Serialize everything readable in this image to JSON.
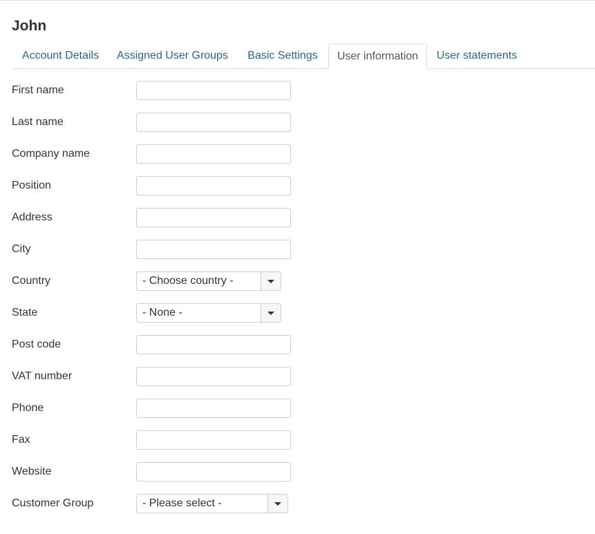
{
  "page": {
    "title": "John"
  },
  "tabs": [
    {
      "label": "Account Details",
      "active": false
    },
    {
      "label": "Assigned User Groups",
      "active": false
    },
    {
      "label": "Basic Settings",
      "active": false
    },
    {
      "label": "User information",
      "active": true
    },
    {
      "label": "User statements",
      "active": false
    }
  ],
  "form": {
    "first_name": {
      "label": "First name",
      "value": ""
    },
    "last_name": {
      "label": "Last name",
      "value": ""
    },
    "company_name": {
      "label": "Company name",
      "value": ""
    },
    "position": {
      "label": "Position",
      "value": ""
    },
    "address": {
      "label": "Address",
      "value": ""
    },
    "city": {
      "label": "City",
      "value": ""
    },
    "country": {
      "label": "Country",
      "selected": "- Choose country -"
    },
    "state": {
      "label": "State",
      "selected": "- None -"
    },
    "post_code": {
      "label": "Post code",
      "value": ""
    },
    "vat_number": {
      "label": "VAT number",
      "value": ""
    },
    "phone": {
      "label": "Phone",
      "value": ""
    },
    "fax": {
      "label": "Fax",
      "value": ""
    },
    "website": {
      "label": "Website",
      "value": ""
    },
    "customer_group": {
      "label": "Customer Group",
      "selected": "- Please select -"
    }
  },
  "icons": {
    "dropdown": "caret-down-icon"
  },
  "colors": {
    "link": "#2a6496",
    "border": "#dddddd",
    "text": "#333333"
  }
}
